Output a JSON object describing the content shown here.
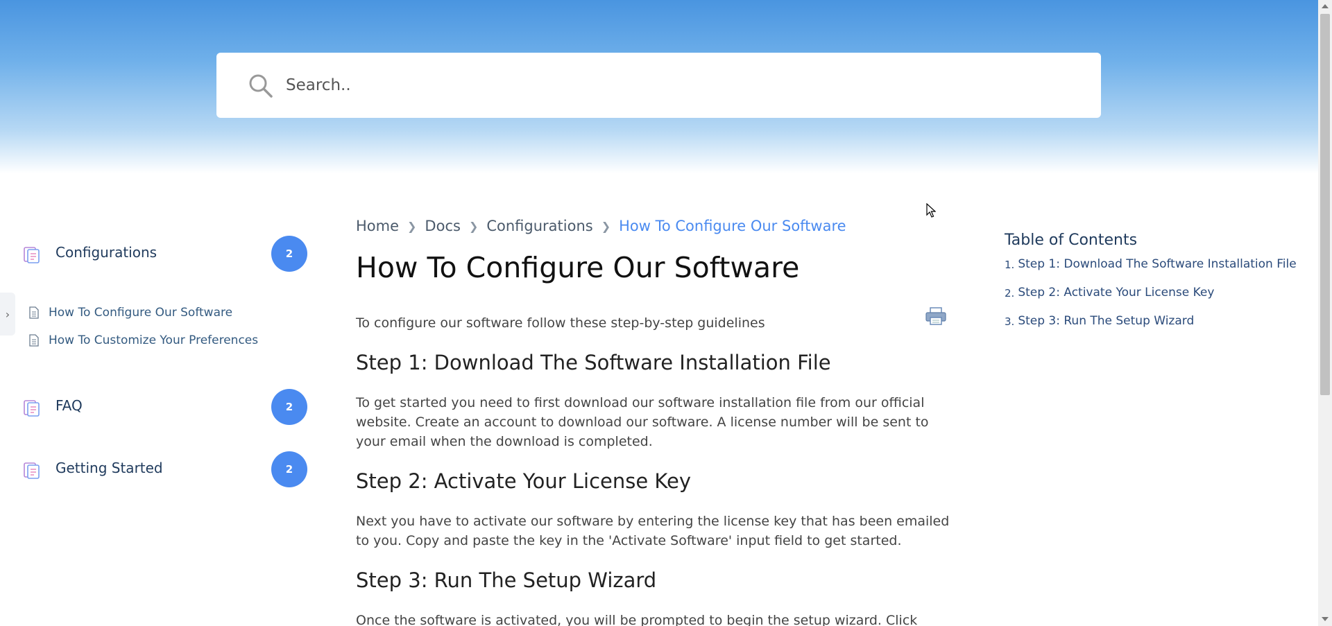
{
  "search": {
    "placeholder": "Search.."
  },
  "sidebar": {
    "categories": [
      {
        "label": "Configurations",
        "count": "2"
      },
      {
        "label": "FAQ",
        "count": "2"
      },
      {
        "label": "Getting Started",
        "count": "2"
      }
    ],
    "sub_items": [
      "How To Configure Our Software",
      "How To Customize Your Preferences"
    ],
    "collapse_glyph": "›"
  },
  "breadcrumb": {
    "items": [
      "Home",
      "Docs",
      "Configurations"
    ],
    "current": "How To Configure Our Software"
  },
  "article": {
    "title": "How To Configure Our Software",
    "intro": "To configure our software follow these step-by-step guidelines",
    "steps": [
      {
        "heading": "Step 1: Download The Software Installation File",
        "body": "To get started you need to first download our software installation file from our official website. Create an account to download our software. A license number will be sent to your email when the download is completed."
      },
      {
        "heading": "Step 2: Activate Your License Key",
        "body": "Next you have to activate our software by entering the license key that has been emailed to you. Copy and paste the key in the 'Activate Software' input field to get started."
      },
      {
        "heading": "Step 3: Run The Setup Wizard",
        "body": "Once the software is activated, you will be prompted to begin the setup wizard. Click 'Run'"
      }
    ]
  },
  "toc": {
    "title": "Table of Contents",
    "items": [
      {
        "num": "1.",
        "label": "Step 1: Download The Software Installation File"
      },
      {
        "num": "2.",
        "label": "Step 2: Activate Your License Key"
      },
      {
        "num": "3.",
        "label": "Step 3: Run The Setup Wizard"
      }
    ]
  },
  "colors": {
    "accent": "#4a8af0",
    "hero_top": "#4a95e0",
    "nav_text": "#1f3a5c"
  }
}
